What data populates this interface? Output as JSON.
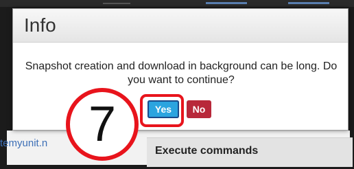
{
  "background": {
    "link_text": "temyunit.n",
    "panel_label": "Execute commands"
  },
  "dialog": {
    "title": "Info",
    "message": "Snapshot creation and download in background can be long. Do you want to continue?",
    "yes_label": "Yes",
    "no_label": "No"
  },
  "annotation": {
    "step_number": "7",
    "highlight_color": "#e8141c"
  },
  "colors": {
    "yes_button": "#2ba4df",
    "no_button": "#b8283a"
  }
}
